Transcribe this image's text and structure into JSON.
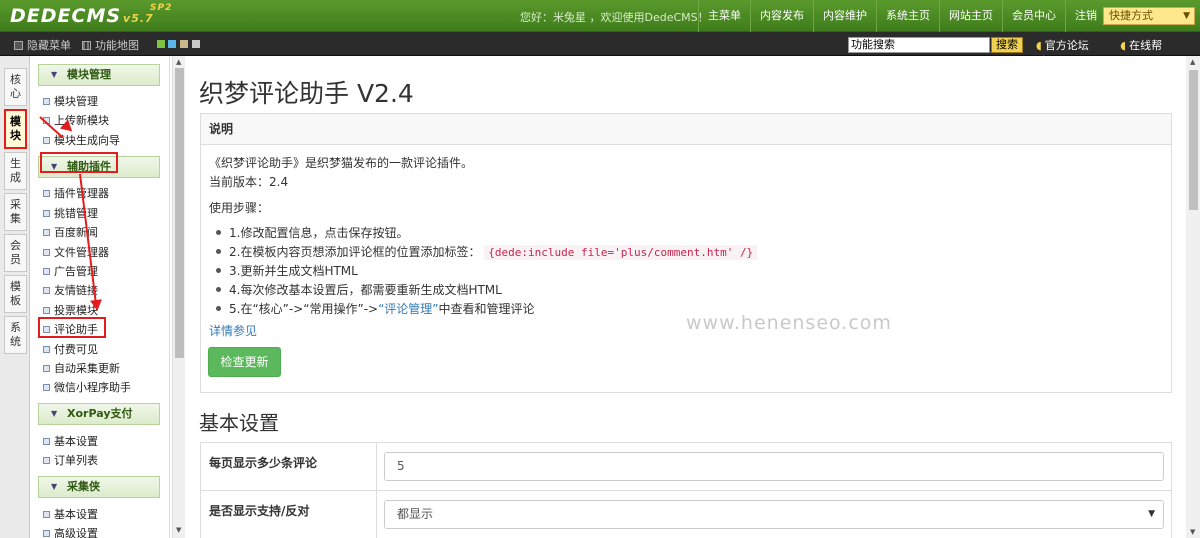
{
  "topbar": {
    "logo_text": "DEDECMS",
    "logo_version": "v5.7",
    "logo_tag": "SP2",
    "welcome": "您好：米兔星 ，欢迎使用DedeCMS！",
    "nav": [
      "主菜单",
      "内容发布",
      "内容维护",
      "系统主页",
      "网站主页",
      "会员中心",
      "注销"
    ],
    "quick_label": "快捷方式",
    "quick_arrow": "▼"
  },
  "subbar": {
    "hide_menu": "隐藏菜单",
    "func_map": "功能地图",
    "search_value": "功能搜索",
    "search_button": "搜索",
    "forum_link": "官方论坛",
    "help_link": "在线帮助"
  },
  "vtabs": [
    {
      "label": "核\n心"
    },
    {
      "label": "模\n块",
      "active": true
    },
    {
      "label": "生\n成"
    },
    {
      "label": "采\n集"
    },
    {
      "label": "会\n员"
    },
    {
      "label": "模\n板"
    },
    {
      "label": "系\n统"
    }
  ],
  "menu": {
    "groups": [
      {
        "title": "模块管理",
        "items": [
          "模块管理",
          "上传新模块",
          "模块生成向导"
        ]
      },
      {
        "title": "辅助插件",
        "items": [
          "插件管理器",
          "挑错管理",
          "百度新闻",
          "文件管理器",
          "广告管理",
          "友情链接",
          "投票模块",
          "评论助手",
          "付费可见",
          "自动采集更新",
          "微信小程序助手"
        ]
      },
      {
        "title": "XorPay支付",
        "items": [
          "基本设置",
          "订单列表"
        ]
      },
      {
        "title": "采集侠",
        "items": [
          "基本设置",
          "高级设置"
        ]
      }
    ]
  },
  "main": {
    "title": "织梦评论助手 V2.4",
    "panel_header": "说明",
    "intro": "《织梦评论助手》是织梦猫发布的一款评论插件。",
    "version": "当前版本：2.4",
    "steps_title": "使用步骤：",
    "steps": [
      "1.修改配置信息，点击保存按钮。",
      "2.在模板内容页想添加评论框的位置添加标签：",
      "3.更新并生成文档HTML",
      "4.每次修改基本设置后，都需要重新生成文档HTML",
      "5.在“核心”->“常用操作”->"
    ],
    "step2_code": "{dede:include file='plus/comment.htm' /}",
    "step5_link": "“评论管理”",
    "step5_tail": "中查看和管理评论",
    "detail_link": "详情参见",
    "check_button": "检查更新",
    "settings_title": "基本设置",
    "settings": [
      {
        "label": "每页显示多少条评论",
        "value": "5"
      },
      {
        "label": "是否显示支持/反对",
        "value": "都显示",
        "arrow": "▼"
      }
    ],
    "watermark": "www.henenseo.com"
  },
  "colors": {
    "accent": "#5cb85c",
    "annotation": "#e21d1d",
    "topbar": "#4a8a24"
  }
}
